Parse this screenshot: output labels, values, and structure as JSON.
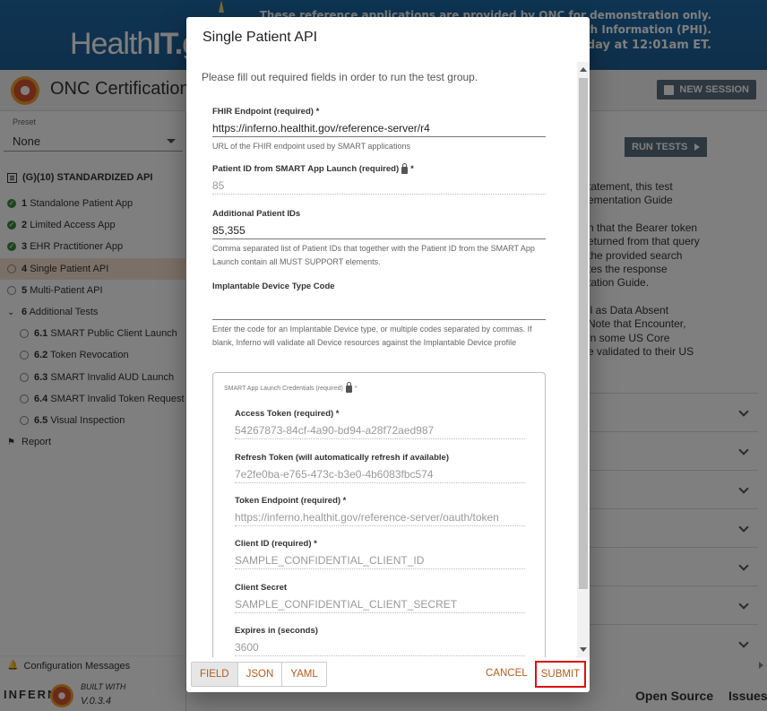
{
  "banner": {
    "logo_light": "Health",
    "logo_bold": "IT.g",
    "notice_line1": "These reference applications are provided by ONC for demonstration only.",
    "notice_line2": "d Health Information (PHI).",
    "notice_line3": "unday at 12:01am ET."
  },
  "appbar": {
    "title": "ONC Certification (",
    "new_session_label": "NEW SESSION"
  },
  "sidebar": {
    "preset_label": "Preset",
    "preset_value": "None",
    "group_title": "(G)(10) STANDARDIZED API",
    "items": [
      {
        "num": "1",
        "label": "Standalone Patient App"
      },
      {
        "num": "2",
        "label": "Limited Access App"
      },
      {
        "num": "3",
        "label": "EHR Practitioner App"
      },
      {
        "num": "4",
        "label": "Single Patient API"
      },
      {
        "num": "5",
        "label": "Multi-Patient API"
      },
      {
        "num": "6",
        "label": "Additional Tests"
      },
      {
        "num": "6.1",
        "label": "SMART Public Client Launch"
      },
      {
        "num": "6.2",
        "label": "Token Revocation"
      },
      {
        "num": "6.3",
        "label": "SMART Invalid AUD Launch"
      },
      {
        "num": "6.4",
        "label": "SMART Invalid Token Request"
      },
      {
        "num": "6.5",
        "label": "Visual Inspection"
      },
      {
        "num": "",
        "label": "Report"
      }
    ],
    "config_messages": "Configuration Messages",
    "brand": "INFERN",
    "built_with": "BUILT WITH",
    "version": "V.0.3.4"
  },
  "main": {
    "run_tests_label": "RUN TESTS",
    "description": [
      "tatement, this test",
      "ementation Guide",
      "",
      "n that the Bearer token",
      "eturned from that query",
      "the provided search",
      "tes the response",
      "tation Guide.",
      "",
      "ll as Data Absent",
      "Note that Encounter,",
      "in some US Core",
      "e validated to their US"
    ],
    "open_source": "Open Source",
    "issues": "Issues"
  },
  "dialog": {
    "title": "Single Patient API",
    "intro": "Please fill out required fields in order to run the test group.",
    "fhir_endpoint": {
      "label": "FHIR Endpoint (required) *",
      "value": "https://inferno.healthit.gov/reference-server/r4",
      "help": "URL of the FHIR endpoint used by SMART applications"
    },
    "patient_id": {
      "label": "Patient ID from SMART App Launch (required)",
      "required_mark": "*",
      "value": "85"
    },
    "additional_patient_ids": {
      "label": "Additional Patient IDs",
      "value": "85,355",
      "help": "Comma separated list of Patient IDs that together with the Patient ID from the SMART App Launch contain all MUST SUPPORT elements."
    },
    "implantable_device": {
      "label": "Implantable Device Type Code",
      "value": "",
      "help": "Enter the code for an Implantable Device type, or multiple codes separated by commas. If blank, Inferno will validate all Device resources against the Implantable Device profile"
    },
    "credentials": {
      "legend": "SMART App Launch Credentials (required)",
      "required_mark": "*",
      "fields": [
        {
          "label": "Access Token (required) *",
          "value": "54267873-84cf-4a90-bd94-a28f72aed987"
        },
        {
          "label": "Refresh Token (will automatically refresh if available)",
          "value": "7e2fe0ba-e765-473c-b3e0-4b6083fbc574"
        },
        {
          "label": "Token Endpoint (required) *",
          "value": "https://inferno.healthit.gov/reference-server/oauth/token"
        },
        {
          "label": "Client ID (required) *",
          "value": "SAMPLE_CONFIDENTIAL_CLIENT_ID"
        },
        {
          "label": "Client Secret",
          "value": "SAMPLE_CONFIDENTIAL_CLIENT_SECRET"
        },
        {
          "label": "Expires in (seconds)",
          "value": "3600"
        }
      ]
    },
    "actions": {
      "field": "FIELD",
      "json": "JSON",
      "yaml": "YAML",
      "cancel": "CANCEL",
      "submit": "SUBMIT"
    }
  },
  "colors": {
    "banner": "#1f5f96",
    "accent": "#b25b1e",
    "active_item": "#f7e1cf",
    "submit_border": "#dd1111",
    "success": "#3a8a3a"
  }
}
